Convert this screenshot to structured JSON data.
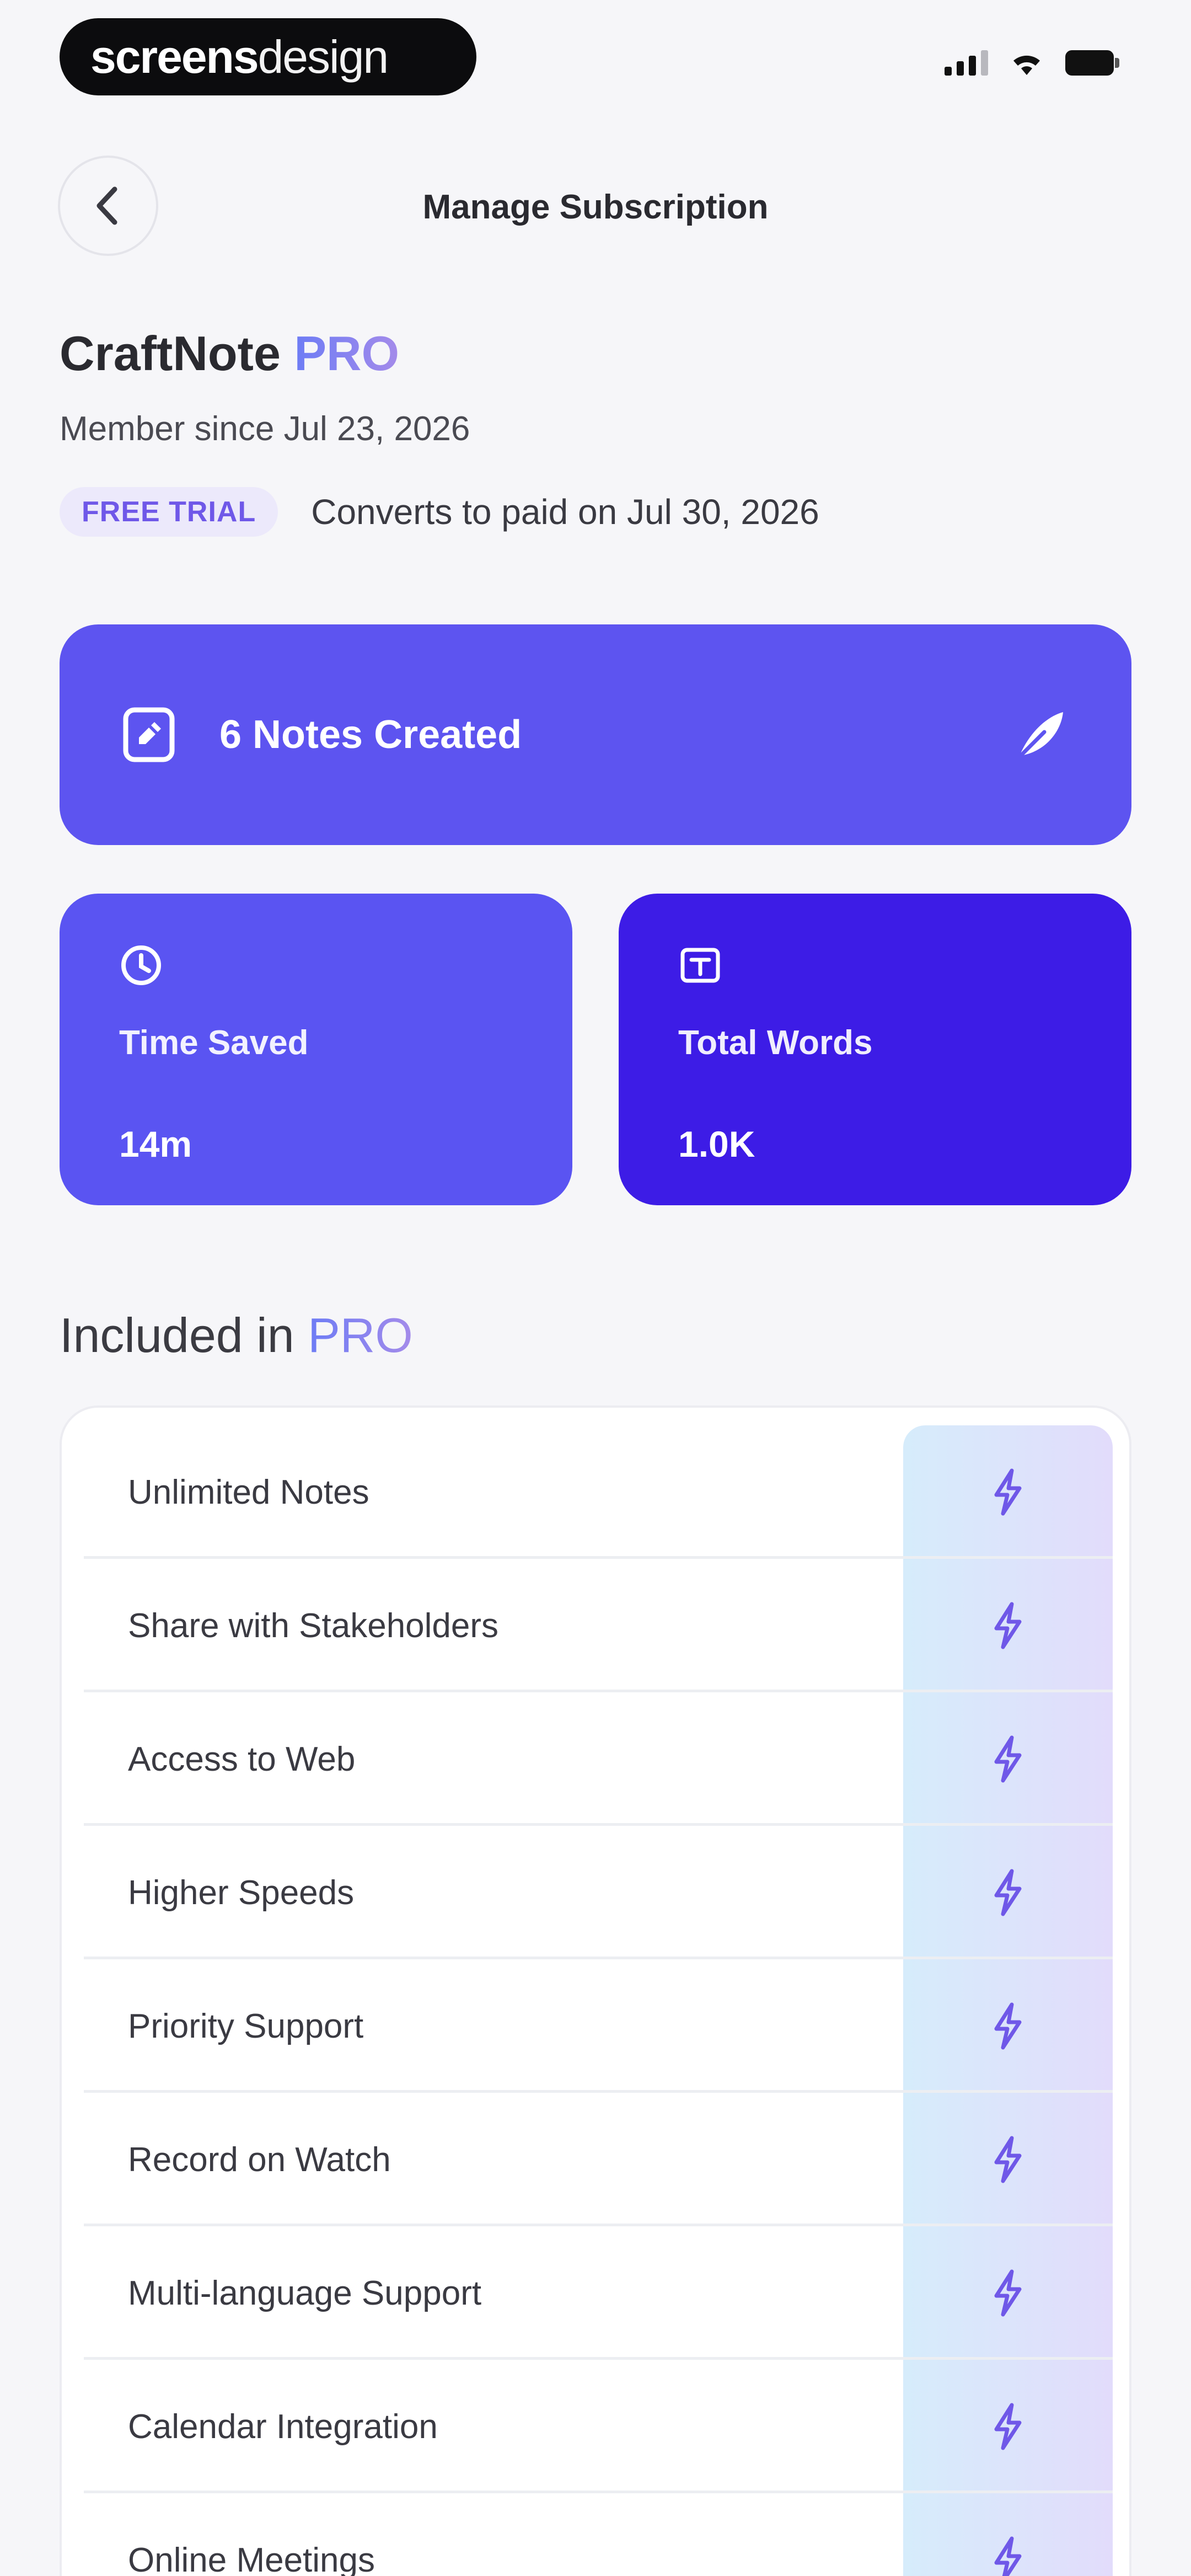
{
  "status_bar": {
    "brand_part1": "screens",
    "brand_part2": "design",
    "icons": [
      "cellular-signal-icon",
      "wifi-icon",
      "battery-icon"
    ]
  },
  "nav": {
    "back_icon": "chevron-left-icon",
    "title": "Manage Subscription"
  },
  "header": {
    "app_name": "CraftNote",
    "plan": "PRO",
    "member_since": "Member since Jul 23, 2026",
    "trial_badge": "FREE TRIAL",
    "trial_text": "Converts to paid on Jul 30, 2026"
  },
  "notes_card": {
    "label": "6 Notes Created",
    "left_icon": "note-icon",
    "right_icon": "feather-icon",
    "color": "#5d54f0"
  },
  "stats": [
    {
      "label": "Time Saved",
      "value": "14m",
      "icon": "clock-icon",
      "color": "#5a54f2"
    },
    {
      "label": "Total Words",
      "value": "1.0K",
      "icon": "text-box-icon",
      "color": "#3d1ce6"
    }
  ],
  "section": {
    "title_prefix": "Included in",
    "title_pro": "PRO"
  },
  "features": [
    {
      "name": "Unlimited Notes",
      "icon": "bolt-icon"
    },
    {
      "name": "Share with Stakeholders",
      "icon": "bolt-icon"
    },
    {
      "name": "Access to Web",
      "icon": "bolt-icon"
    },
    {
      "name": "Higher Speeds",
      "icon": "bolt-icon"
    },
    {
      "name": "Priority Support",
      "icon": "bolt-icon"
    },
    {
      "name": "Record on Watch",
      "icon": "bolt-icon"
    },
    {
      "name": "Multi-language Support",
      "icon": "bolt-icon"
    },
    {
      "name": "Calendar Integration",
      "icon": "bolt-icon"
    },
    {
      "name": "Online Meetings",
      "icon": "bolt-icon"
    }
  ],
  "colors": {
    "accent": "#5d54f0",
    "accent_dark": "#3d1ce6",
    "pro_gradient_start": "#6d7cf5",
    "pro_gradient_end": "#a48bea",
    "bolt": "#6f58e8"
  }
}
